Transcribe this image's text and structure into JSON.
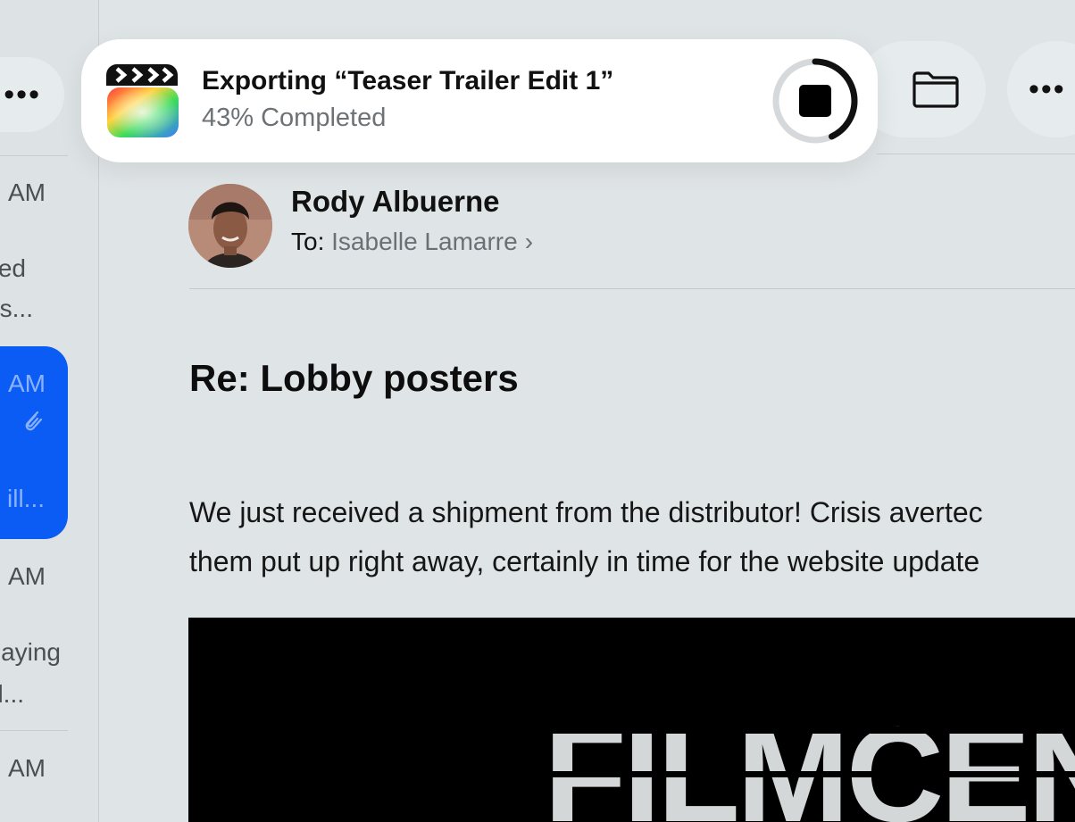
{
  "export_toast": {
    "title": "Exporting “Teaser Trailer Edit 1”",
    "status": "43% Completed",
    "progress": 0.43,
    "app_icon": "final-cut-clapper-icon",
    "stop_icon": "stop-icon"
  },
  "list": {
    "more_label": "•••",
    "items": [
      {
        "time": "AM",
        "snippet": [
          "ed",
          "s..."
        ]
      },
      {
        "time": "AM",
        "snippet": [
          "",
          "ill..."
        ],
        "selected": true,
        "attachment": true
      },
      {
        "time": "AM",
        "snippet": [
          "aying",
          "l..."
        ]
      },
      {
        "time": "AM",
        "snippet": []
      }
    ]
  },
  "toolbar": {
    "folder_icon": "folder-icon",
    "more_label": "•••"
  },
  "message": {
    "sender": "Rody Albuerne",
    "to_label": "To:",
    "recipient": "Isabelle Lamarre",
    "recipient_chevron": "›",
    "subject": "Re: Lobby posters",
    "body_lines": [
      "We just received a shipment from the distributor! Crisis avertec",
      "them put up right away, certainly in time for the website update"
    ],
    "poster_text": "FILMCENTE"
  },
  "colors": {
    "selection": "#0a5cf5",
    "background": "#dfe4e6",
    "toast_bg": "#ffffff"
  }
}
